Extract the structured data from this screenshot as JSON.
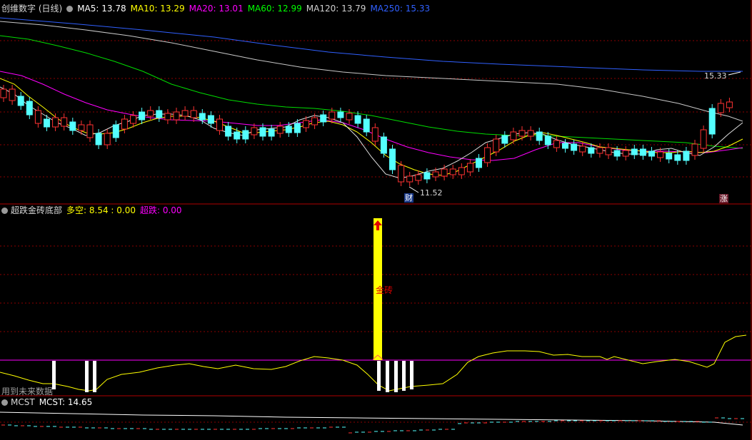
{
  "main": {
    "title": "创维数字 (日线)",
    "ma": [
      {
        "label": "MA5: 13.78",
        "color": "#ffffff"
      },
      {
        "label": "MA10: 13.29",
        "color": "#ffff00"
      },
      {
        "label": "MA20: 13.01",
        "color": "#ff00ff"
      },
      {
        "label": "MA60: 12.99",
        "color": "#00ff00"
      },
      {
        "label": "MA120: 13.79",
        "color": "#d0d0d0"
      },
      {
        "label": "MA250: 15.33",
        "color": "#3060ff"
      }
    ],
    "high_label": "15.33",
    "low_label": "11.52",
    "fin_badge": "财",
    "up_badge": "涨"
  },
  "indicator": {
    "title": "超跌金砖底部",
    "duokong_label": "多空: 8.54 : 0.00",
    "chaodie_label": "超跌: 0.00",
    "signal_text": "金砖",
    "future_note": "用到未来数据"
  },
  "mcst": {
    "title": "MCST",
    "value_label": "MCST: 14.65"
  },
  "colors": {
    "up": "#ff3232",
    "down": "#54ffff",
    "grid": "#8b0000",
    "ma5": "#ffffff",
    "ma10": "#ffff00",
    "ma20": "#ff00ff",
    "ma60": "#00ff00",
    "ma120": "#d0d0d0",
    "ma250": "#3060ff"
  }
}
